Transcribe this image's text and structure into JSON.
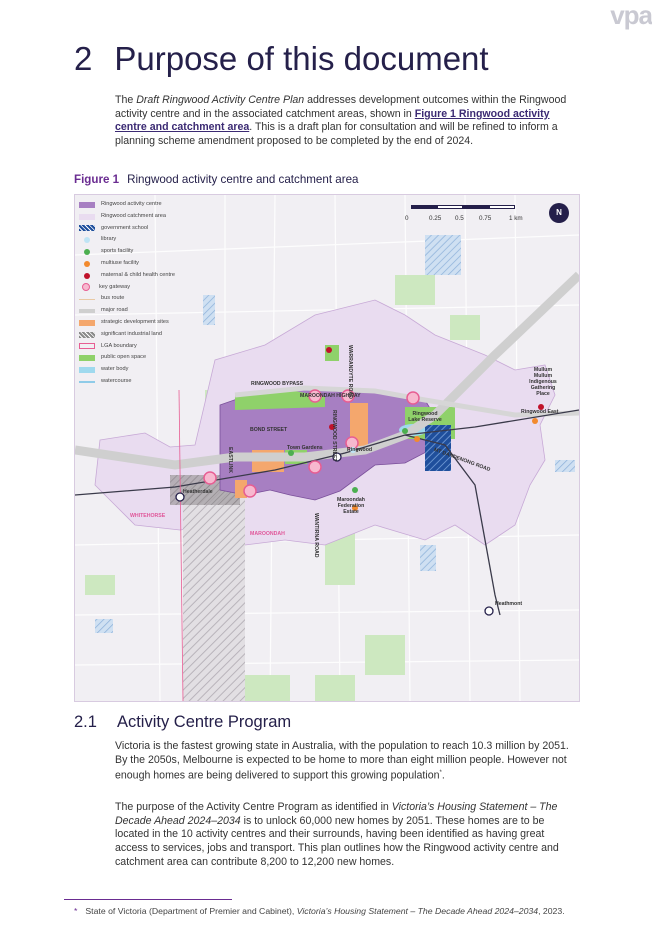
{
  "header": {
    "logo_text": "vpa"
  },
  "section": {
    "number": "2",
    "title": "Purpose of this document"
  },
  "intro": {
    "text_before_italic": "The ",
    "italic": "Draft Ringwood Activity Centre Plan",
    "text_after_italic": " addresses development outcomes within the Ringwood activity centre and in the associated catchment areas, shown in ",
    "link": "Figure 1 Ringwood activity centre and catchment area",
    "text_end": ". This is a draft plan for consultation and will be refined to inform a planning scheme amendment proposed to be completed by the end of 2024."
  },
  "figure": {
    "number": "Figure 1",
    "caption": "Ringwood activity centre and catchment area",
    "legend": [
      {
        "label": "Ringwood activity centre",
        "kind": "fill",
        "color": "#a77fc2"
      },
      {
        "label": "Ringwood catchment area",
        "kind": "fill",
        "color": "#e9dcf0"
      },
      {
        "label": "government school",
        "kind": "hatch",
        "color": "#1f4f9c"
      },
      {
        "label": "library",
        "kind": "dot",
        "color": "#bfe4f5"
      },
      {
        "label": "sports facility",
        "kind": "dot",
        "color": "#4caf50"
      },
      {
        "label": "multiuse facility",
        "kind": "dot",
        "color": "#f28a2e"
      },
      {
        "label": "maternal & child health centre",
        "kind": "dot",
        "color": "#c0122b"
      },
      {
        "label": "key gateway",
        "kind": "ring",
        "color": "#e75e93"
      },
      {
        "label": "bus route",
        "kind": "line",
        "color": "#e9c9a4"
      },
      {
        "label": "major road",
        "kind": "arrow",
        "color": "#cfcfcf"
      },
      {
        "label": "strategic development sites",
        "kind": "fill",
        "color": "#f4a76d"
      },
      {
        "label": "significant industrial land",
        "kind": "hatch",
        "color": "#8a8a8a"
      },
      {
        "label": "LGA boundary",
        "kind": "outline",
        "color": "#e75e93"
      },
      {
        "label": "public open space",
        "kind": "fill",
        "color": "#8fd16a"
      },
      {
        "label": "water body",
        "kind": "fill",
        "color": "#9fd9ee"
      },
      {
        "label": "watercourse",
        "kind": "line",
        "color": "#8fcbe8"
      }
    ],
    "scale": {
      "labels": [
        "0",
        "0.25",
        "0.5",
        "0.75",
        "1 km"
      ]
    },
    "north": "N",
    "places": [
      {
        "text": "RINGWOOD BYPASS",
        "style": "road"
      },
      {
        "text": "MAROONDAH HIGHWAY",
        "style": "road"
      },
      {
        "text": "WARRANDYTE ROAD",
        "style": "road"
      },
      {
        "text": "RINGWOOD STREET",
        "style": "road"
      },
      {
        "text": "BOND STREET",
        "style": "road"
      },
      {
        "text": "EASTLINK",
        "style": "road"
      },
      {
        "text": "WANTIRNA ROAD",
        "style": "road"
      },
      {
        "text": "MT DANDENONG ROAD",
        "style": "road"
      },
      {
        "text": "Ringwood Lake Reserve",
        "style": "place"
      },
      {
        "text": "Ringwood",
        "style": "station"
      },
      {
        "text": "Heatherdale",
        "style": "station"
      },
      {
        "text": "Ringwood East",
        "style": "station"
      },
      {
        "text": "Heathmont",
        "style": "station"
      },
      {
        "text": "Mullum Mullum Indigenous Gathering Place",
        "style": "place"
      },
      {
        "text": "Maroondah Federation Estate",
        "style": "place"
      },
      {
        "text": "Town Gardens",
        "style": "place"
      },
      {
        "text": "WHITEHORSE",
        "style": "lga"
      },
      {
        "text": "MAROONDAH",
        "style": "lga"
      }
    ]
  },
  "subsection": {
    "number": "2.1",
    "title": "Activity Centre Program"
  },
  "paragraph1": {
    "text": "Victoria is the fastest growing state in Australia, with the population to reach 10.3 million by 2051. By the 2050s, Melbourne is expected to be home to more than eight million people. However not enough homes are being delivered to support this growing population",
    "sup": "*",
    "end": "."
  },
  "paragraph2": {
    "start": "The purpose of the Activity Centre Program as identified in ",
    "italic": "Victoria’s Housing Statement – The Decade Ahead 2024–2034",
    "rest": " is to unlock 60,000 new homes by 2051. These homes are to be located in the 10 activity centres and their surrounds, having been identified as having great access to services, jobs and transport. This plan outlines how the Ringwood activity centre and catchment area can contribute 8,200 to 12,200 new homes."
  },
  "footnote": {
    "mark": "*",
    "start": "State of Victoria (Department of Premier and Cabinet), ",
    "italic": "Victoria’s Housing Statement – The Decade Ahead 2024–2034",
    "end": ", 2023."
  }
}
